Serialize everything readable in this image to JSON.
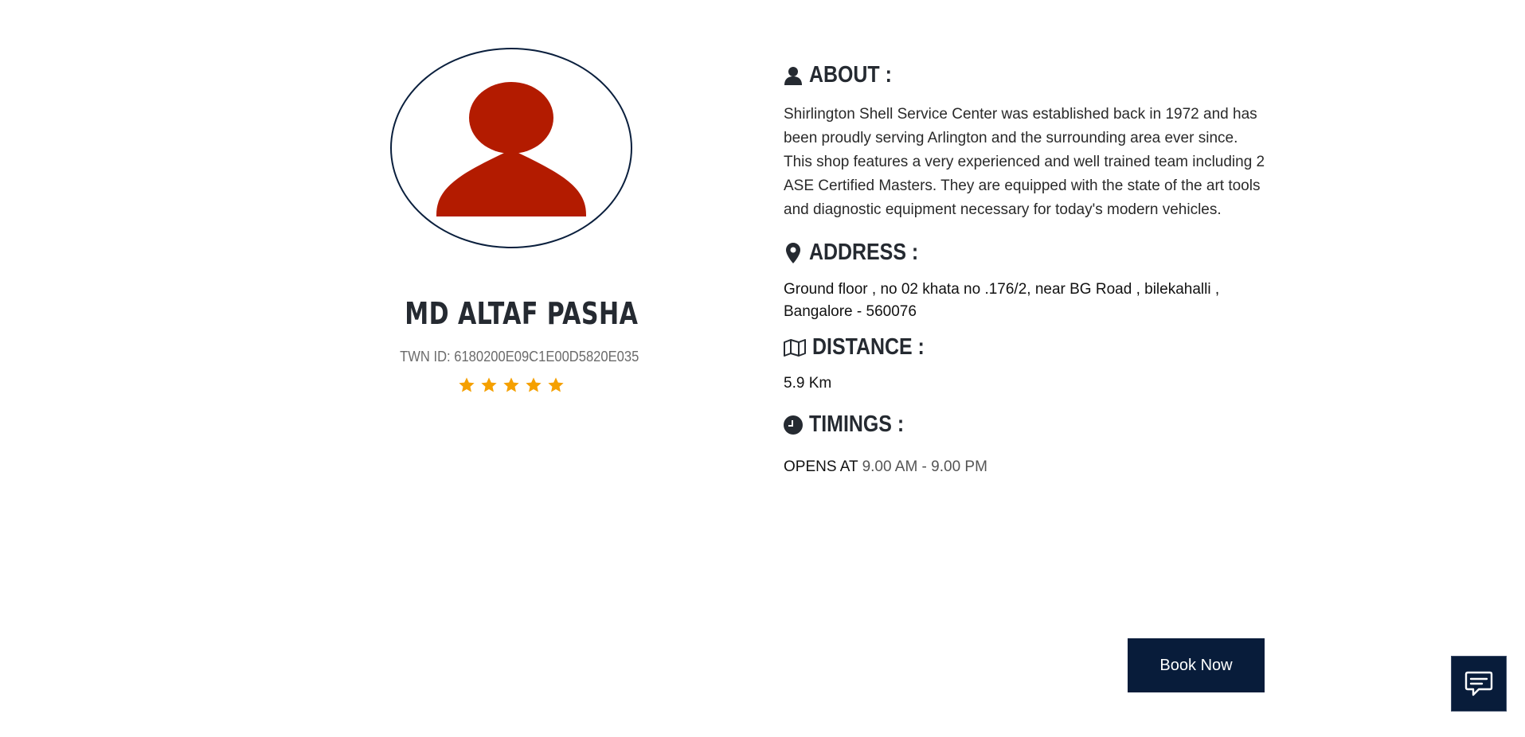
{
  "profile": {
    "name": "MD ALTAF PASHA",
    "twn_label": "TWN ID: ",
    "twn_id": "6180200E09C1E00D5820E035",
    "rating": 5,
    "rating_max": 5,
    "avatar_icon": "user-silhouette-icon",
    "avatar_color": "#b31b00",
    "star_color": "#f5a000"
  },
  "about": {
    "icon": "user-icon",
    "title": "ABOUT :",
    "text": "Shirlington Shell Service Center was established back in 1972 and has been proudly serving Arlington and the surrounding area ever since. This shop features a very experienced and well trained team including 2 ASE Certified Masters. They are equipped with the state of the art tools and diagnostic equipment necessary for today's modern vehicles."
  },
  "address": {
    "icon": "map-pin-icon",
    "title": "ADDRESS :",
    "text": "Ground floor , no 02 khata no .176/2, near BG Road , bilekahalli , Bangalore - 560076"
  },
  "distance": {
    "icon": "map-icon",
    "title": "DISTANCE :",
    "value": "5.9 Km"
  },
  "timings": {
    "icon": "clock-icon",
    "title": "TIMINGS :",
    "label": "OPENS AT",
    "hours": "9.00 AM - 9.00 PM"
  },
  "actions": {
    "book_label": "Book Now",
    "chat_icon": "chat-message-icon"
  },
  "colors": {
    "primary_dark": "#081c3a",
    "heading": "#252a31"
  }
}
